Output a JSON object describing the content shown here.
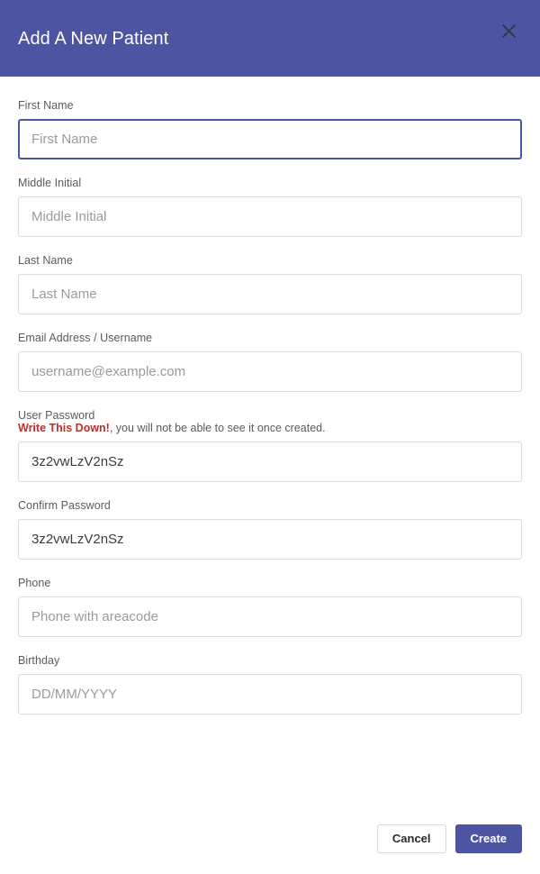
{
  "header": {
    "title": "Add A New Patient",
    "close_icon": "close-icon"
  },
  "form": {
    "fields": [
      {
        "key": "first_name",
        "label": "First Name",
        "placeholder": "First Name",
        "value": "",
        "focused": true
      },
      {
        "key": "middle_initial",
        "label": "Middle Initial",
        "placeholder": "Middle Initial",
        "value": "",
        "focused": false
      },
      {
        "key": "last_name",
        "label": "Last Name",
        "placeholder": "Last Name",
        "value": "",
        "focused": false
      },
      {
        "key": "email",
        "label": "Email Address / Username",
        "placeholder": "username@example.com",
        "value": "",
        "focused": false
      },
      {
        "key": "user_password",
        "label": "User Password",
        "warning_bold": "Write This Down!",
        "warning_rest": ", you will not be able to see it once created.",
        "placeholder": "",
        "value": "3z2vwLzV2nSz",
        "focused": false
      },
      {
        "key": "confirm_password",
        "label": "Confirm Password",
        "placeholder": "",
        "value": "3z2vwLzV2nSz",
        "focused": false
      },
      {
        "key": "phone",
        "label": "Phone",
        "placeholder": "Phone with areacode",
        "value": "",
        "focused": false
      },
      {
        "key": "birthday",
        "label": "Birthday",
        "placeholder": "DD/MM/YYYY",
        "value": "",
        "focused": false
      }
    ]
  },
  "footer": {
    "cancel_label": "Cancel",
    "create_label": "Create"
  },
  "colors": {
    "header_background": "#4d54a1",
    "primary_button": "#4d54a1",
    "warning_text": "#b8312a",
    "focus_border": "#4b56a6",
    "input_border": "#dcdcdc"
  }
}
